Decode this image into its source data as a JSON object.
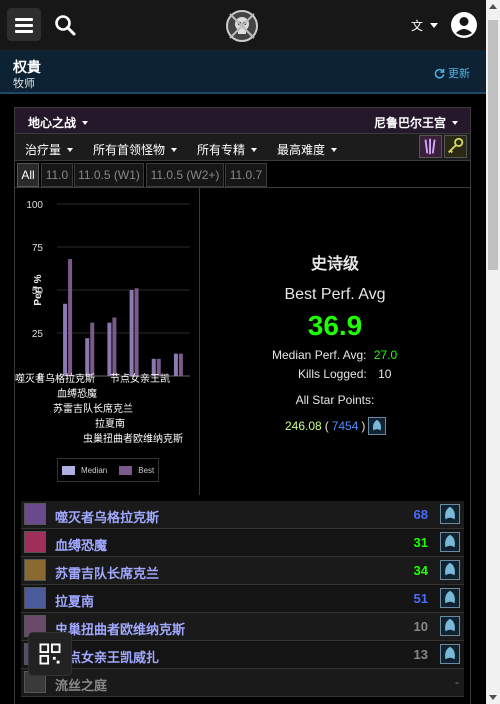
{
  "char": {
    "name": "权貴",
    "class": "牧师",
    "update_label": "更新"
  },
  "zone": {
    "raid": "地心之战",
    "instance": "尼鲁巴尔王宫"
  },
  "filters": {
    "metric": "治疗量",
    "bosses": "所有首领怪物",
    "specs": "所有专精",
    "difficulty": "最高难度"
  },
  "tabs": [
    "All",
    "11.0",
    "11.0.5 (W1)",
    "11.0.5 (W2+)",
    "11.0.7"
  ],
  "stats": {
    "difficulty_label": "史诗级",
    "best_perf_label": "Best Perf. Avg",
    "best_perf_value": "36.9",
    "median_label": "Median Perf. Avg:",
    "median_value": "27.0",
    "kills_label": "Kills Logged:",
    "kills_value": "10",
    "star_label": "All Star Points:",
    "star_points": "246.08",
    "star_paren_open": "(",
    "star_rank": "7454",
    "star_paren_close": ")"
  },
  "chart_data": {
    "type": "bar",
    "ylabel": "Perf %",
    "ylim": [
      0,
      100
    ],
    "yticks": [
      "100",
      "75",
      "50",
      "25",
      "0"
    ],
    "categories": [
      "噬灭者乌格拉克斯",
      "血缚恐魔",
      "苏雷吉队长席克兰",
      "拉夏南",
      "虫巢扭曲者欧维纳克斯",
      "节点女亲王凯威扎"
    ],
    "xtick_labels": [
      "噬灭者乌格拉克斯",
      "血缚恐魔",
      "苏雷吉队长席克兰",
      "拉夏南",
      "虫巢扭曲者欧维纳克斯",
      "节点女亲王凯"
    ],
    "series": [
      {
        "name": "Median",
        "values": [
          42,
          22,
          31,
          50,
          10,
          13
        ],
        "color": "#8a7ab0"
      },
      {
        "name": "Best",
        "values": [
          68,
          31,
          34,
          51,
          10,
          13
        ],
        "color": "#7a5a8a"
      }
    ],
    "legend": "bottom"
  },
  "bosses": [
    {
      "name": "噬灭者乌格拉克斯",
      "score": "68",
      "color": "#4a6bff",
      "icon_color": "#6a4a8a"
    },
    {
      "name": "血缚恐魔",
      "score": "31",
      "color": "#1eff00",
      "icon_color": "#a0305a"
    },
    {
      "name": "苏雷吉队长席克兰",
      "score": "34",
      "color": "#1eff00",
      "icon_color": "#8a6a30"
    },
    {
      "name": "拉夏南",
      "score": "51",
      "color": "#4a6bff",
      "icon_color": "#4a5a9a"
    },
    {
      "name": "虫巢扭曲者欧维纳克斯",
      "score": "10",
      "color": "#888888",
      "icon_color": "#6a4a6a"
    },
    {
      "name": "节点女亲王凯威扎",
      "score": "13",
      "color": "#888888",
      "icon_color": "#5a4a7a"
    },
    {
      "name": "流丝之庭",
      "score": "-",
      "color": "#888888",
      "icon_color": "#3a3a3a"
    }
  ]
}
